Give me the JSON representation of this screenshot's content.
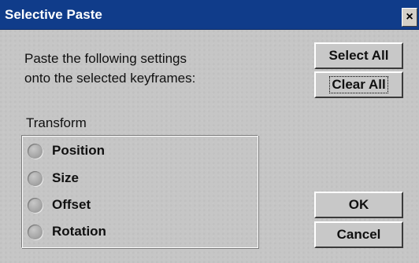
{
  "window": {
    "title": "Selective Paste",
    "close_label": "×"
  },
  "instructions": {
    "line1": "Paste the following settings",
    "line2": "onto the selected keyframes:"
  },
  "buttons": {
    "select_all": "Select All",
    "clear_all": "Clear All",
    "ok": "OK",
    "cancel": "Cancel"
  },
  "transform": {
    "label": "Transform",
    "options": [
      {
        "label": "Position",
        "checked": false
      },
      {
        "label": "Size",
        "checked": false
      },
      {
        "label": "Offset",
        "checked": false
      },
      {
        "label": "Rotation",
        "checked": false
      }
    ]
  },
  "colors": {
    "titlebar": "#103c8a",
    "dialog_bg": "#c6c6c6"
  }
}
